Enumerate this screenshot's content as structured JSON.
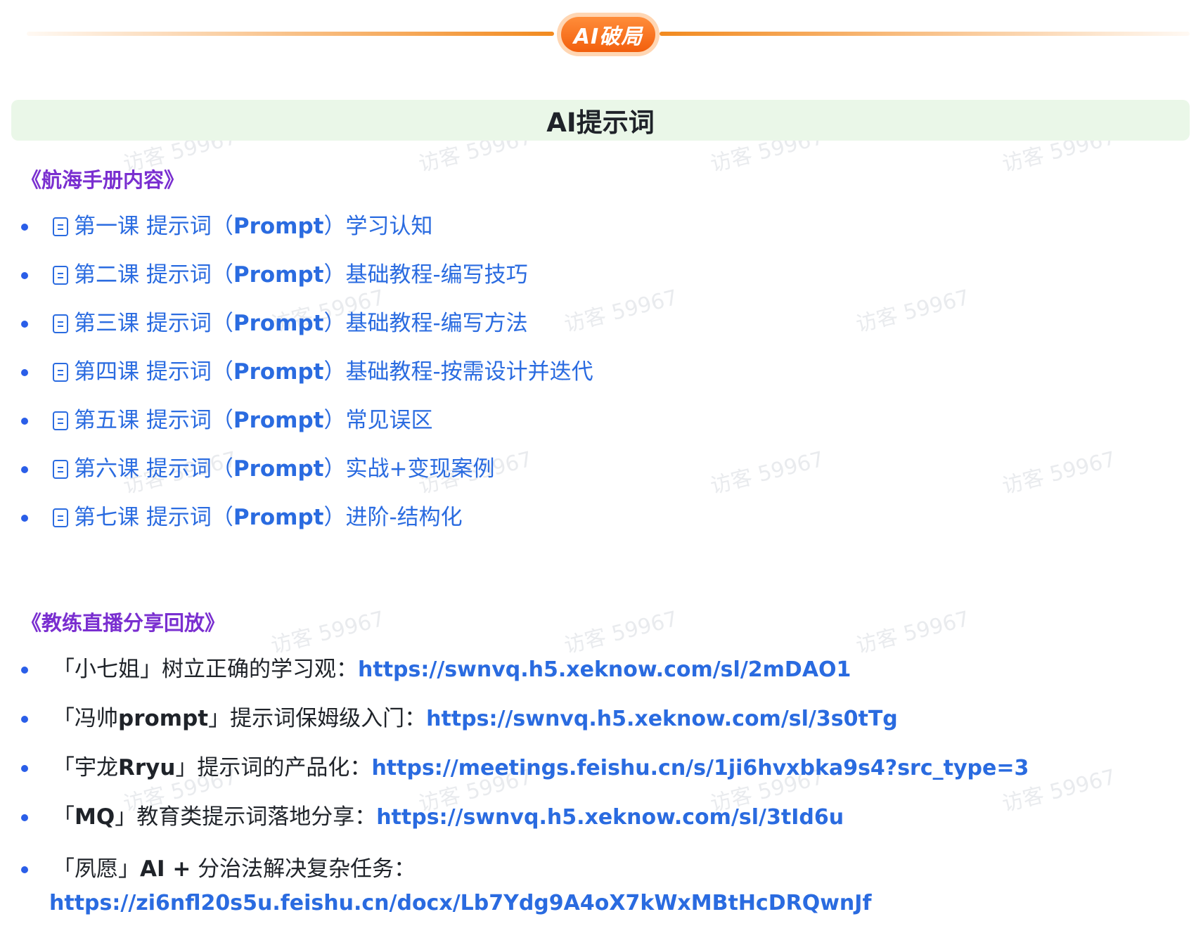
{
  "banner": {
    "badge_text": "AI破局"
  },
  "page_title": "AI提示词",
  "watermark_text": "访客 59967",
  "handbook": {
    "heading": "《航海手册内容》",
    "items": [
      {
        "pre": "第一课  提示词（",
        "bold": "Prompt",
        "post": "）学习认知"
      },
      {
        "pre": "第二课 提示词（",
        "bold": "Prompt",
        "post": "）基础教程-编写技巧"
      },
      {
        "pre": "第三课  提示词（",
        "bold": "Prompt",
        "post": "）基础教程-编写方法"
      },
      {
        "pre": "第四课 提示词（",
        "bold": "Prompt",
        "post": "）基础教程-按需设计并迭代"
      },
      {
        "pre": "第五课 提示词（",
        "bold": "Prompt",
        "post": "）常见误区"
      },
      {
        "pre": "第六课 提示词（",
        "bold": "Prompt",
        "post": "）实战+变现案例"
      },
      {
        "pre": "第七课 提示词（",
        "bold": "Prompt",
        "post": "）进阶-结构化"
      }
    ]
  },
  "replay": {
    "heading": "《教练直播分享回放》",
    "items": [
      {
        "pre": "「小七姐」树立正确的学习观：",
        "bold": "",
        "mid": "",
        "url": "https://swnvq.h5.xeknow.com/sl/2mDAO1"
      },
      {
        "pre": "「冯帅",
        "bold": "prompt",
        "mid": "」提示词保姆级入门：",
        "url": "https://swnvq.h5.xeknow.com/sl/3s0tTg"
      },
      {
        "pre": "「宇龙",
        "bold": "Rryu",
        "mid": "」提示词的产品化：",
        "url": "https://meetings.feishu.cn/s/1ji6hvxbka9s4?src_type=3"
      },
      {
        "pre": "「",
        "bold": "MQ",
        "mid": "」教育类提示词落地分享：",
        "url": "https://swnvq.h5.xeknow.com/sl/3tId6u"
      },
      {
        "pre": "「夙愿」",
        "bold": "AI +",
        "mid": " 分治法解决复杂任务：",
        "url": "https://zi6nfl20s5u.feishu.cn/docx/Lb7Ydg9A4oX7kWxMBtHcDRQwnJf"
      }
    ]
  }
}
